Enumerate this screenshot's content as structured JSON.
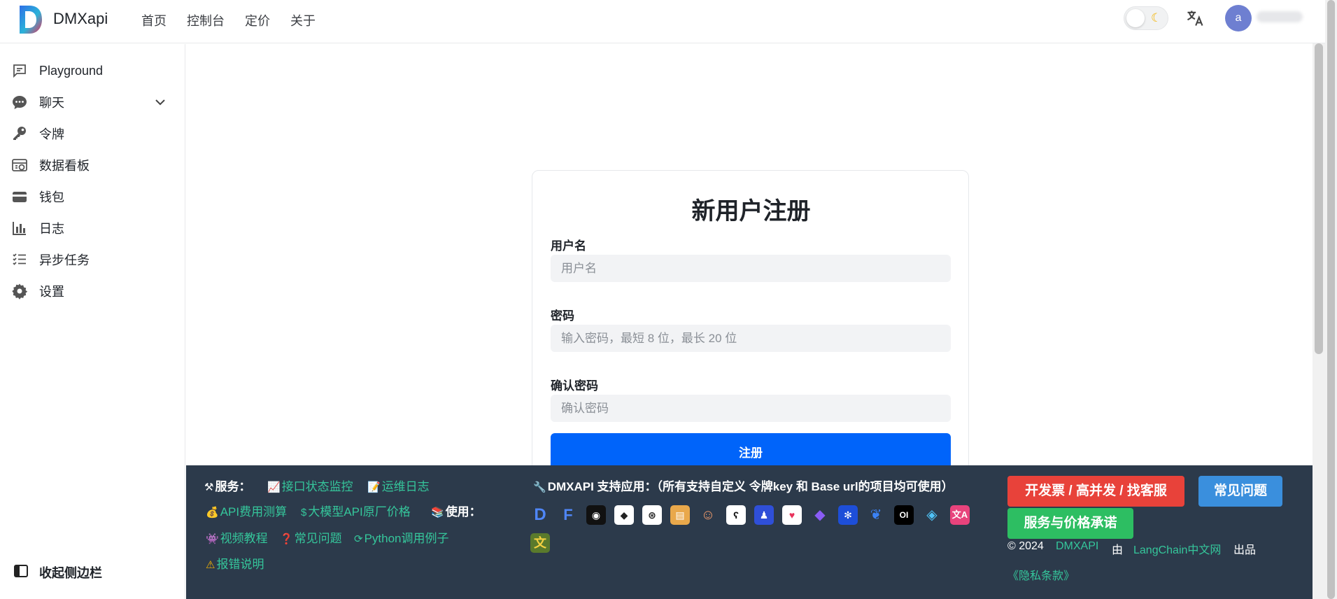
{
  "app": {
    "brand": "DMXapi"
  },
  "topnav": [
    "首页",
    "控制台",
    "定价",
    "关于"
  ],
  "user": {
    "avatar_letter": "a"
  },
  "sidebar": {
    "items": [
      {
        "label": "Playground",
        "icon": "playground-icon"
      },
      {
        "label": "聊天",
        "icon": "chat-icon"
      },
      {
        "label": "令牌",
        "icon": "key-icon"
      },
      {
        "label": "数据看板",
        "icon": "dashboard-icon"
      },
      {
        "label": "钱包",
        "icon": "wallet-icon"
      },
      {
        "label": "日志",
        "icon": "bar-chart-icon"
      },
      {
        "label": "异步任务",
        "icon": "task-list-icon"
      },
      {
        "label": "设置",
        "icon": "gear-icon"
      }
    ],
    "collapse_label": "收起侧边栏"
  },
  "register": {
    "title": "新用户注册",
    "username_label": "用户名",
    "username_placeholder": "用户名",
    "password_label": "密码",
    "password_placeholder": "输入密码，最短 8 位，最长 20 位",
    "confirm_label": "确认密码",
    "confirm_placeholder": "确认密码",
    "submit_label": "注册"
  },
  "footer": {
    "services_label": "服务：",
    "status_monitor": "接口状态监控",
    "ops_log": "运维日志",
    "api_cost": "API费用测算",
    "model_prices": "大模型API原厂价格",
    "usage_label": "使用：",
    "video_tutorial": "视频教程",
    "faq_link": "常见问题",
    "python_example": "Python调用例子",
    "error_guide": "报错说明",
    "supported_apps": "DMXAPI 支持应用：（所有支持自定义 令牌key 和 Base url的项目均可使用）",
    "btn_invoice": "开发票 / 高并发 / 找客服",
    "btn_faq": "常见问题",
    "btn_promise": "服务与价格承诺",
    "copyright": "© 2024",
    "copy_brand": "DMXAPI",
    "copy_by": "由",
    "copy_org": "LangChain中文网",
    "copy_made": "出品",
    "privacy": "《隐私条款》",
    "colors": {
      "bg": "#2c3a4b",
      "link": "#35c69b",
      "red": "#e8423a",
      "blue": "#3a8fdd",
      "green": "#2dbe62"
    }
  }
}
